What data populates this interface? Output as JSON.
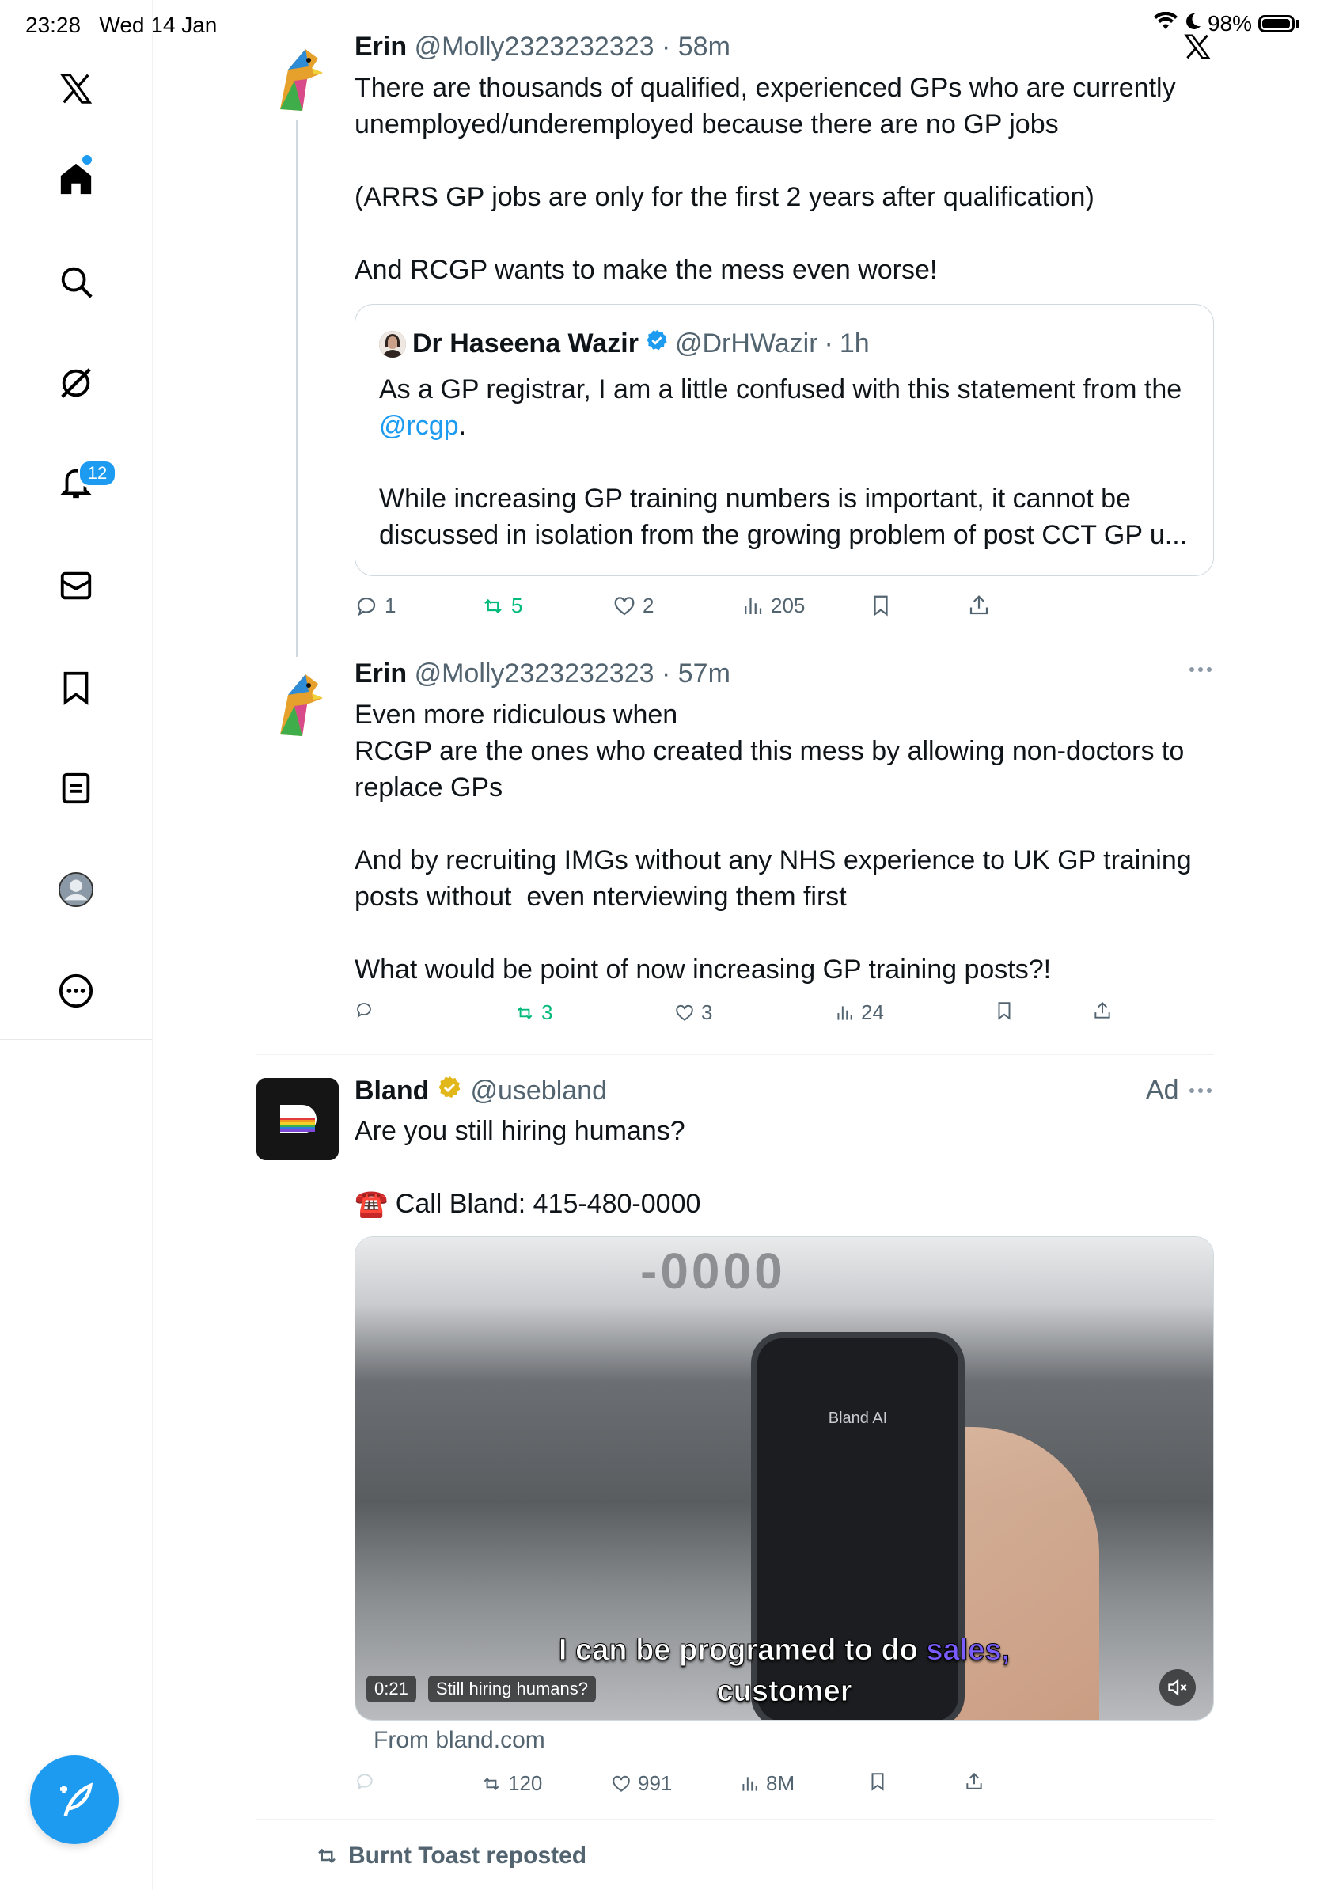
{
  "status_bar": {
    "time": "23:28",
    "date": "Wed 14 Jan",
    "battery": "98%",
    "battery_fill": 0.98
  },
  "sidebar": {
    "items": [
      {
        "label": "X logo"
      },
      {
        "label": "Home"
      },
      {
        "label": "Search"
      },
      {
        "label": "Grok"
      },
      {
        "label": "Notifications",
        "badge": "12"
      },
      {
        "label": "Messages"
      },
      {
        "label": "Bookmarks"
      },
      {
        "label": "Lists"
      },
      {
        "label": "Profile"
      },
      {
        "label": "More"
      }
    ]
  },
  "tweets": [
    {
      "name": "Erin",
      "handle": "@Molly2323232323",
      "time": "58m",
      "text": "There are thousands of qualified, experienced GPs who are currently unemployed/underemployed because there are no GP jobs\n\n(ARRS GP jobs are only for the first 2 years after qualification)\n\nAnd RCGP wants to make the mess even worse!",
      "quote": {
        "name": "Dr Haseena Wazir",
        "handle": "@DrHWazir",
        "time": "1h",
        "text_before": "As a GP registrar, I am a little confused with this statement from the ",
        "mention": "@rcgp",
        "text_after": ".\n\nWhile increasing GP training numbers is important, it cannot be discussed in isolation from the growing problem of post CCT GP u..."
      },
      "replies": "1",
      "reposts": "5",
      "likes": "2",
      "views": "205"
    },
    {
      "name": "Erin",
      "handle": "@Molly2323232323",
      "time": "57m",
      "text": "Even more ridiculous when\nRCGP are the ones who created this mess by allowing non-doctors to replace GPs\n\nAnd by recruiting IMGs without any NHS experience to UK GP training posts without  even nterviewing them first\n\nWhat would be point of now increasing GP training posts?!",
      "replies": "",
      "reposts": "3",
      "likes": "3",
      "views": "24"
    },
    {
      "name": "Bland",
      "handle": "@usebland",
      "ad_label": "Ad",
      "text_line1": "Are you still hiring humans?",
      "text_line2": "☎️ Call Bland: 415-480-0000",
      "video": {
        "phone_label": "Bland AI",
        "caption_part1": "I can be programed to do ",
        "caption_highlight": "sales,",
        "caption_line2": "customer",
        "duration": "0:21",
        "title": "Still hiring humans?"
      },
      "from": "From bland.com",
      "replies": "",
      "reposts": "120",
      "likes": "991",
      "views": "8M"
    }
  ],
  "repost_banner": "Burnt Toast reposted",
  "colors": {
    "accent": "#1d9bf0",
    "repost_green": "#00ba7c",
    "muted": "#536471",
    "gold_badge": "#e2b719"
  }
}
